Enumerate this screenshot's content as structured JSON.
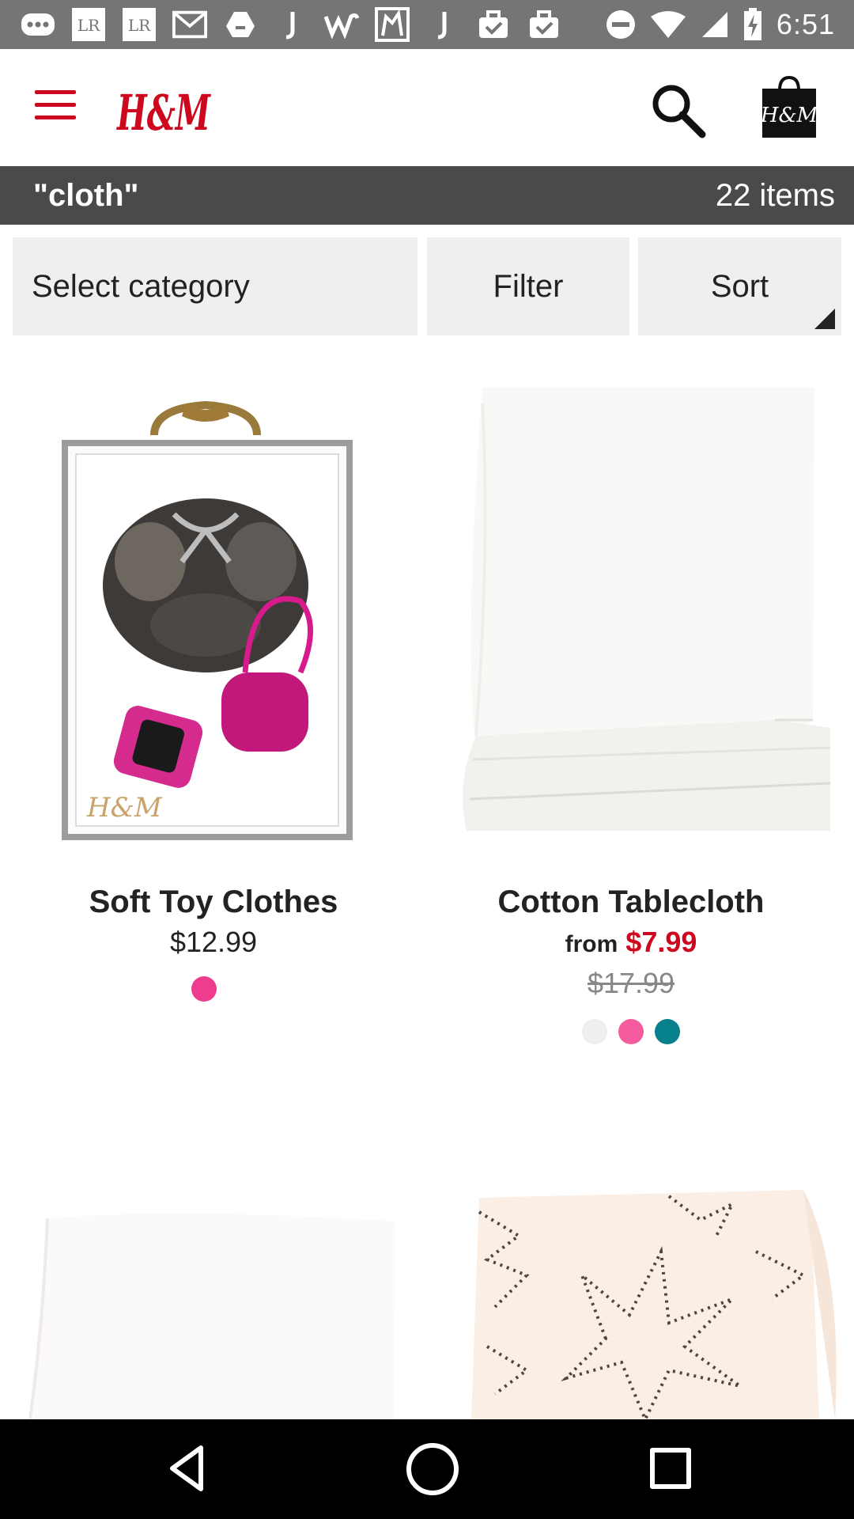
{
  "status_bar": {
    "time": "6:51",
    "left_icons": [
      "more-icon",
      "lr-icon",
      "lr-icon",
      "mail-icon",
      "drive-icon",
      "j-icon",
      "w-icon",
      "map-icon",
      "j-icon",
      "briefcase-check-icon",
      "briefcase-check-icon"
    ],
    "right_icons": [
      "do-not-disturb-icon",
      "wifi-icon",
      "signal-icon",
      "battery-charging-icon"
    ],
    "lr_label": "LR"
  },
  "header": {
    "logo_text": "H&M",
    "bag_logo_text": "H&M",
    "brand_color": "#cc071e"
  },
  "search": {
    "query": "\"cloth\"",
    "count": "22 items"
  },
  "controls": {
    "category": "Select category",
    "filter": "Filter",
    "sort": "Sort"
  },
  "products": [
    {
      "name": "Soft Toy Clothes",
      "price": "$12.99",
      "swatches": [
        "#ee3d8f"
      ],
      "image_watermark": "H&M"
    },
    {
      "name": "Cotton Tablecloth",
      "from_label": "from",
      "sale_price": "$7.99",
      "original_price": "$17.99",
      "swatches": [
        "#eeeeee",
        "#f45c9e",
        "#06808a"
      ]
    },
    {
      "name": "",
      "price": ""
    },
    {
      "name": "",
      "price": ""
    }
  ],
  "nav": {
    "icons": [
      "back-icon",
      "home-icon",
      "recents-icon"
    ]
  }
}
